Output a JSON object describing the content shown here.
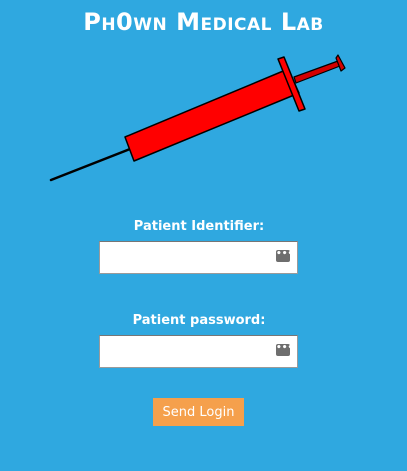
{
  "header": {
    "title": "Ph0wn Medical Lab"
  },
  "logo": {
    "icon": "syringe-icon",
    "barrel_color": "#ff0000",
    "outline_color": "#000000",
    "plunger_color": "#cc0000"
  },
  "form": {
    "identifier_label": "Patient Identifier:",
    "identifier_value": "",
    "password_label": "Patient password:",
    "password_value": "",
    "submit_label": "Send Login",
    "field_icon": "password-manager-icon"
  },
  "colors": {
    "background": "#2fa8e0",
    "button": "#f5a04c",
    "text": "#ffffff"
  }
}
